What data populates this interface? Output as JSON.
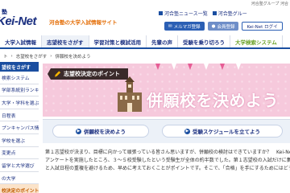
{
  "header": {
    "top_note": "河合塾グループ 河合",
    "logo_mark": "塾",
    "logo": "Kei-Net",
    "tagline": "河合塾の大学入試情報サイト",
    "links": [
      "河合塾ニュース一覧",
      "河合塾グルー"
    ],
    "buttons": {
      "magazine": "メルマガ登録",
      "member": "会員登録",
      "login": "Kei-Net ログイ"
    }
  },
  "nav": {
    "items": [
      "大学入試情報",
      "志望校をさがす",
      "学習対策と模試活用",
      "先輩の声",
      "受験を乗り切ろう",
      "大学検索システム"
    ]
  },
  "breadcrumb": [
    "ト",
    "志望校をさがす",
    "併願校を決めよう"
  ],
  "sidebar": {
    "title": "望校をさがす",
    "items": [
      "検索システム",
      "学部系統別ランキング表",
      "大学・学科を選ぶ",
      "日程表",
      "プンキャンパス情報",
      "学校を選ぶ",
      "変更点",
      "留学と大学選び",
      "の大学",
      "校決定のポイント"
    ],
    "active_index": 9
  },
  "banner": {
    "ribbon": "志望校決定のポイント",
    "title": "併願校を決めよう"
  },
  "actions": {
    "btn1": "併願校を決めよう",
    "btn2": "受験スケジュールを立てよう",
    "icon": "▶"
  },
  "body": {
    "lines": [
      "第１志望校が決まり、目標に向かって頑張っている皆さん思いますが、併願校の検討はできていますか？　Kei-Net特設",
      "アンケートを実施したところ、３～５校受験したという受験生が全体の約半数でした。第１志望校の入試だけに集中",
      "と入試日程の重複を避けるため、早めに考えておくことがポイントです。そこで、「合格」を手にするためにはどう"
    ]
  },
  "colors": {
    "brand": "#1a2f80",
    "accent": "#e4700b",
    "banner_bg": "#f6c9dc",
    "active_side": "#fbe3c9"
  }
}
